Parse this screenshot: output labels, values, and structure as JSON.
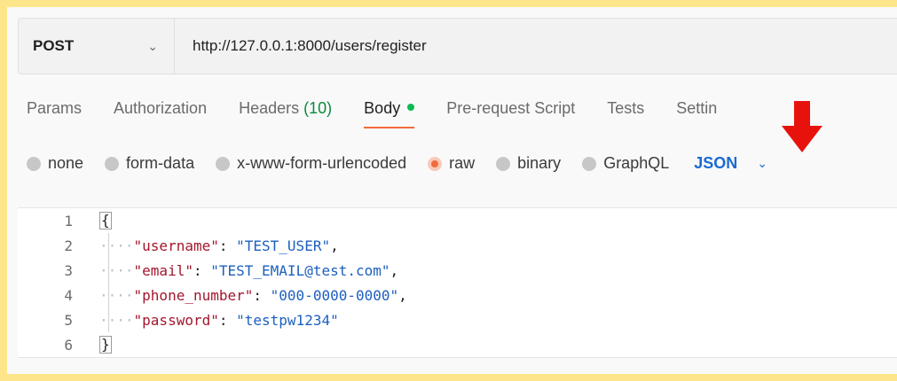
{
  "request": {
    "method": "POST",
    "url": "http://127.0.0.1:8000/users/register"
  },
  "tabs": [
    {
      "label": "Params"
    },
    {
      "label": "Authorization"
    },
    {
      "label": "Headers",
      "count": "(10)"
    },
    {
      "label": "Body"
    },
    {
      "label": "Pre-request Script"
    },
    {
      "label": "Tests"
    },
    {
      "label": "Settin"
    }
  ],
  "body_types": [
    {
      "label": "none"
    },
    {
      "label": "form-data"
    },
    {
      "label": "x-www-form-urlencoded"
    },
    {
      "label": "raw"
    },
    {
      "label": "binary"
    },
    {
      "label": "GraphQL"
    }
  ],
  "body_format": "JSON",
  "editor": {
    "line_numbers": [
      "1",
      "2",
      "3",
      "4",
      "5",
      "6"
    ],
    "open_brace": "{",
    "close_brace": "}",
    "indent": "····",
    "fields": [
      {
        "key": "\"username\"",
        "value": "\"TEST_USER\"",
        "comma": ","
      },
      {
        "key": "\"email\"",
        "value": "\"TEST_EMAIL@test.com\"",
        "comma": ","
      },
      {
        "key": "\"phone_number\"",
        "value": "\"000-0000-0000\"",
        "comma": ","
      },
      {
        "key": "\"password\"",
        "value": "\"testpw1234\"",
        "comma": ""
      }
    ]
  },
  "colors": {
    "highlight_border": "#fde68a",
    "accent": "#f26b3a",
    "annotation_arrow": "#e8120c",
    "json_key": "#a3162d",
    "json_string": "#1d5fbf"
  },
  "icons": {
    "method_dropdown": "chevron-down-icon",
    "format_dropdown": "chevron-down-icon",
    "annotation": "red-arrow-down-icon"
  }
}
